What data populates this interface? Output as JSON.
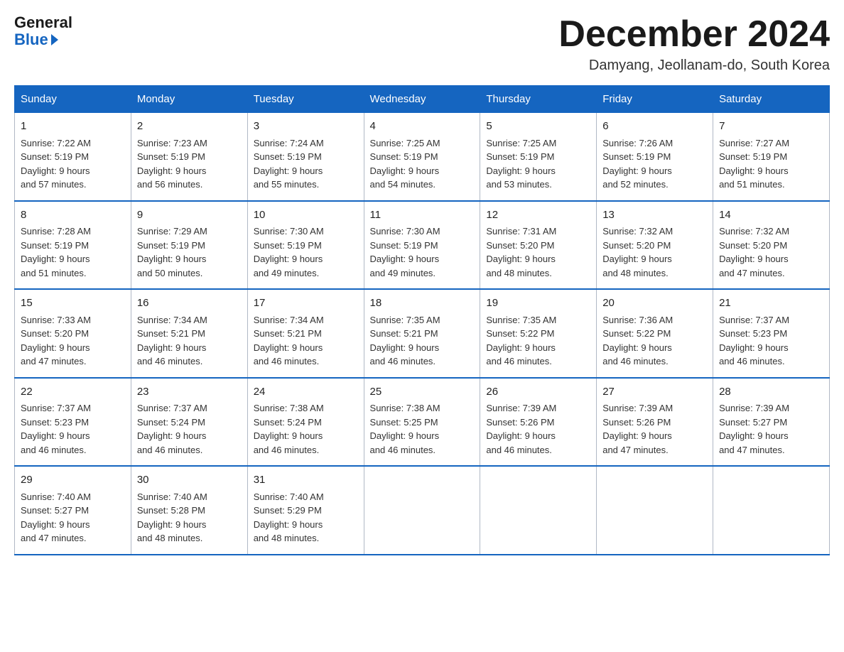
{
  "logo": {
    "general": "General",
    "blue": "Blue"
  },
  "header": {
    "month": "December 2024",
    "location": "Damyang, Jeollanam-do, South Korea"
  },
  "days_of_week": [
    "Sunday",
    "Monday",
    "Tuesday",
    "Wednesday",
    "Thursday",
    "Friday",
    "Saturday"
  ],
  "weeks": [
    [
      {
        "day": "1",
        "info": "Sunrise: 7:22 AM\nSunset: 5:19 PM\nDaylight: 9 hours\nand 57 minutes."
      },
      {
        "day": "2",
        "info": "Sunrise: 7:23 AM\nSunset: 5:19 PM\nDaylight: 9 hours\nand 56 minutes."
      },
      {
        "day": "3",
        "info": "Sunrise: 7:24 AM\nSunset: 5:19 PM\nDaylight: 9 hours\nand 55 minutes."
      },
      {
        "day": "4",
        "info": "Sunrise: 7:25 AM\nSunset: 5:19 PM\nDaylight: 9 hours\nand 54 minutes."
      },
      {
        "day": "5",
        "info": "Sunrise: 7:25 AM\nSunset: 5:19 PM\nDaylight: 9 hours\nand 53 minutes."
      },
      {
        "day": "6",
        "info": "Sunrise: 7:26 AM\nSunset: 5:19 PM\nDaylight: 9 hours\nand 52 minutes."
      },
      {
        "day": "7",
        "info": "Sunrise: 7:27 AM\nSunset: 5:19 PM\nDaylight: 9 hours\nand 51 minutes."
      }
    ],
    [
      {
        "day": "8",
        "info": "Sunrise: 7:28 AM\nSunset: 5:19 PM\nDaylight: 9 hours\nand 51 minutes."
      },
      {
        "day": "9",
        "info": "Sunrise: 7:29 AM\nSunset: 5:19 PM\nDaylight: 9 hours\nand 50 minutes."
      },
      {
        "day": "10",
        "info": "Sunrise: 7:30 AM\nSunset: 5:19 PM\nDaylight: 9 hours\nand 49 minutes."
      },
      {
        "day": "11",
        "info": "Sunrise: 7:30 AM\nSunset: 5:19 PM\nDaylight: 9 hours\nand 49 minutes."
      },
      {
        "day": "12",
        "info": "Sunrise: 7:31 AM\nSunset: 5:20 PM\nDaylight: 9 hours\nand 48 minutes."
      },
      {
        "day": "13",
        "info": "Sunrise: 7:32 AM\nSunset: 5:20 PM\nDaylight: 9 hours\nand 48 minutes."
      },
      {
        "day": "14",
        "info": "Sunrise: 7:32 AM\nSunset: 5:20 PM\nDaylight: 9 hours\nand 47 minutes."
      }
    ],
    [
      {
        "day": "15",
        "info": "Sunrise: 7:33 AM\nSunset: 5:20 PM\nDaylight: 9 hours\nand 47 minutes."
      },
      {
        "day": "16",
        "info": "Sunrise: 7:34 AM\nSunset: 5:21 PM\nDaylight: 9 hours\nand 46 minutes."
      },
      {
        "day": "17",
        "info": "Sunrise: 7:34 AM\nSunset: 5:21 PM\nDaylight: 9 hours\nand 46 minutes."
      },
      {
        "day": "18",
        "info": "Sunrise: 7:35 AM\nSunset: 5:21 PM\nDaylight: 9 hours\nand 46 minutes."
      },
      {
        "day": "19",
        "info": "Sunrise: 7:35 AM\nSunset: 5:22 PM\nDaylight: 9 hours\nand 46 minutes."
      },
      {
        "day": "20",
        "info": "Sunrise: 7:36 AM\nSunset: 5:22 PM\nDaylight: 9 hours\nand 46 minutes."
      },
      {
        "day": "21",
        "info": "Sunrise: 7:37 AM\nSunset: 5:23 PM\nDaylight: 9 hours\nand 46 minutes."
      }
    ],
    [
      {
        "day": "22",
        "info": "Sunrise: 7:37 AM\nSunset: 5:23 PM\nDaylight: 9 hours\nand 46 minutes."
      },
      {
        "day": "23",
        "info": "Sunrise: 7:37 AM\nSunset: 5:24 PM\nDaylight: 9 hours\nand 46 minutes."
      },
      {
        "day": "24",
        "info": "Sunrise: 7:38 AM\nSunset: 5:24 PM\nDaylight: 9 hours\nand 46 minutes."
      },
      {
        "day": "25",
        "info": "Sunrise: 7:38 AM\nSunset: 5:25 PM\nDaylight: 9 hours\nand 46 minutes."
      },
      {
        "day": "26",
        "info": "Sunrise: 7:39 AM\nSunset: 5:26 PM\nDaylight: 9 hours\nand 46 minutes."
      },
      {
        "day": "27",
        "info": "Sunrise: 7:39 AM\nSunset: 5:26 PM\nDaylight: 9 hours\nand 47 minutes."
      },
      {
        "day": "28",
        "info": "Sunrise: 7:39 AM\nSunset: 5:27 PM\nDaylight: 9 hours\nand 47 minutes."
      }
    ],
    [
      {
        "day": "29",
        "info": "Sunrise: 7:40 AM\nSunset: 5:27 PM\nDaylight: 9 hours\nand 47 minutes."
      },
      {
        "day": "30",
        "info": "Sunrise: 7:40 AM\nSunset: 5:28 PM\nDaylight: 9 hours\nand 48 minutes."
      },
      {
        "day": "31",
        "info": "Sunrise: 7:40 AM\nSunset: 5:29 PM\nDaylight: 9 hours\nand 48 minutes."
      },
      null,
      null,
      null,
      null
    ]
  ]
}
